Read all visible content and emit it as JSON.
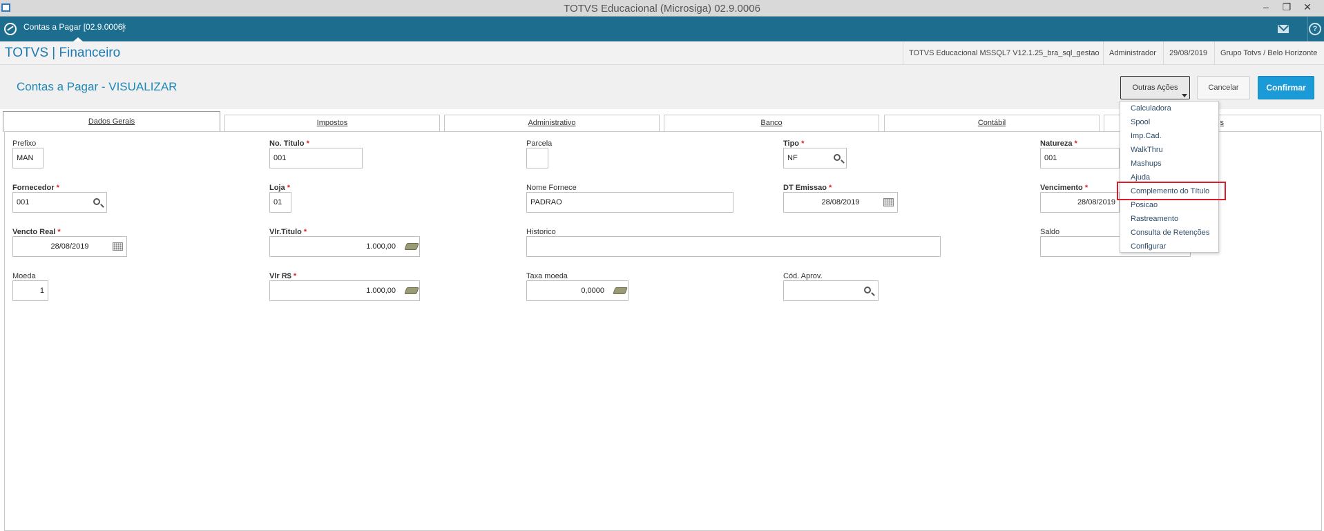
{
  "window": {
    "title": "TOTVS Educacional (Microsiga) 02.9.0006",
    "controls": [
      "minimize-icon",
      "restore-icon",
      "close-icon"
    ]
  },
  "tabstrip": {
    "active_tab": "Contas a Pagar [02.9.0006]",
    "close_glyph": "×",
    "icons": [
      "home-icon",
      "mail-icon",
      "help-icon"
    ]
  },
  "header": {
    "brand": "TOTVS | Financeiro",
    "environment": "TOTVS Educacional MSSQL7 V12.1.25_bra_sql_gestao",
    "user": "Administrador",
    "date": "29/08/2019",
    "company": "Grupo Totvs / Belo Horizonte"
  },
  "page": {
    "title": "Contas a Pagar - VISUALIZAR",
    "buttons": {
      "outras_acoes": "Outras Ações",
      "cancelar": "Cancelar",
      "confirmar": "Confirmar"
    }
  },
  "folder_tabs": [
    {
      "label": "Dados Gerais",
      "active": true
    },
    {
      "label": "Impostos",
      "active": false
    },
    {
      "label": "Administrativo",
      "active": false
    },
    {
      "label": "Banco",
      "active": false
    },
    {
      "label": "Contábil",
      "active": false
    },
    {
      "label": "s",
      "active": false
    }
  ],
  "form": {
    "prefixo": {
      "label": "Prefixo",
      "value": "MAN"
    },
    "no_titulo": {
      "label": "No. Titulo",
      "value": "001",
      "required": "*"
    },
    "parcela": {
      "label": "Parcela",
      "value": ""
    },
    "tipo": {
      "label": "Tipo",
      "value": "NF",
      "required": "*"
    },
    "natureza": {
      "label": "Natureza",
      "value": "001",
      "required": "*"
    },
    "fornecedor": {
      "label": "Fornecedor",
      "value": "001",
      "required": "*"
    },
    "loja": {
      "label": "Loja",
      "value": "01",
      "required": "*"
    },
    "nome_fornece": {
      "label": "Nome Fornece",
      "value": "PADRAO"
    },
    "dt_emissao": {
      "label": "DT Emissao",
      "value": "28/08/2019",
      "required": "*"
    },
    "vencimento": {
      "label": "Vencimento",
      "value": "28/08/2019",
      "required": "*"
    },
    "vencto_real": {
      "label": "Vencto Real",
      "value": "28/08/2019",
      "required": "*"
    },
    "vlr_titulo": {
      "label": "Vlr.Titulo",
      "value": "1.000,00",
      "required": "*"
    },
    "historico": {
      "label": "Historico",
      "value": ""
    },
    "saldo": {
      "label": "Saldo",
      "value": ""
    },
    "moeda": {
      "label": "Moeda",
      "value": "1"
    },
    "vlr_rs": {
      "label": "Vlr R$",
      "value": "1.000,00",
      "required": "*"
    },
    "taxa_moeda": {
      "label": "Taxa moeda",
      "value": "0,0000"
    },
    "cod_aprov": {
      "label": "Cód. Aprov.",
      "value": ""
    }
  },
  "menu": {
    "items": [
      "Calculadora",
      "Spool",
      "Imp.Cad.",
      "WalkThru",
      "Mashups",
      "Ajuda",
      "Complemento do Título",
      "Posicao",
      "Rastreamento",
      "Consulta de Retenções",
      "Configurar"
    ],
    "highlighted": "Complemento do Título"
  }
}
